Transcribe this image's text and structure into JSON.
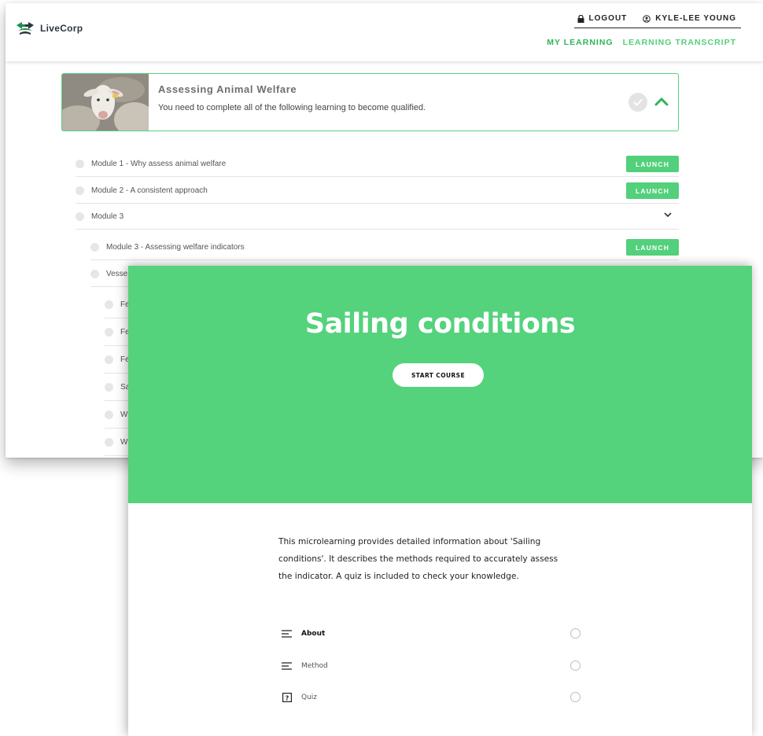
{
  "header": {
    "logo_text": "LiveCorp",
    "logout_label": "LOGOUT",
    "user_name": "KYLE-LEE YOUNG",
    "nav_my_learning": "MY LEARNING",
    "nav_transcript": "LEARNING TRANSCRIPT"
  },
  "course": {
    "title": "Assessing Animal Welfare",
    "description": "You need to complete all of the following learning to become qualified."
  },
  "modules": [
    {
      "label": "Module 1 - Why assess animal welfare",
      "action": "LAUNCH"
    },
    {
      "label": "Module 2 - A consistent approach",
      "action": "LAUNCH"
    },
    {
      "label": "Module 3"
    },
    {
      "label": "Module 3 - Assessing welfare indicators",
      "action": "LAUNCH"
    },
    {
      "label": "Vesse"
    },
    {
      "label": "Fe"
    },
    {
      "label": "Fe"
    },
    {
      "label": "Fe"
    },
    {
      "label": "Sa"
    },
    {
      "label": "W"
    },
    {
      "label": "W"
    }
  ],
  "rise": {
    "title": "Sailing conditions",
    "start_label": "START COURSE",
    "intro_line1": "This microlearning provides detailed information about 'Sailing",
    "intro_line2": "conditions'. It describes the methods required to accurately assess",
    "intro_line3": "the indicator. A quiz is included to check your knowledge.",
    "lessons": [
      {
        "name": "About",
        "icon": "lines-icon"
      },
      {
        "name": "Method",
        "icon": "lines-icon"
      },
      {
        "name": "Quiz",
        "icon": "quiz-icon"
      }
    ]
  },
  "colors": {
    "accent": "#53d07b",
    "accent_dark": "#2fb45a"
  }
}
